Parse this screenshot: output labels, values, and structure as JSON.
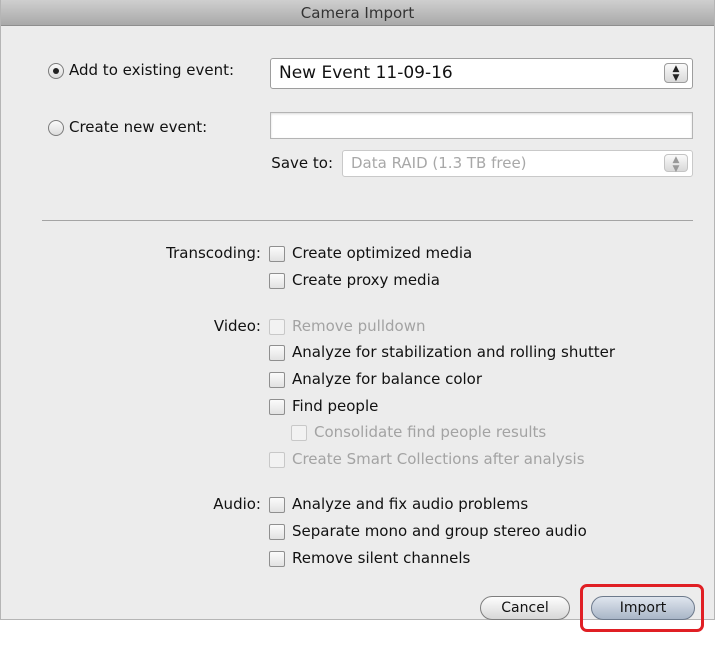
{
  "window": {
    "title": "Camera Import"
  },
  "event": {
    "add_existing_label": "Add to existing event:",
    "add_existing_checked": true,
    "existing_event_value": "New Event 11-09-16",
    "create_new_label": "Create new event:",
    "create_new_checked": false,
    "new_event_value": "",
    "save_to_label": "Save to:",
    "save_to_value": "Data RAID   (1.3 TB free)"
  },
  "transcoding": {
    "label": "Transcoding:",
    "options": [
      {
        "label": "Create optimized media",
        "checked": false,
        "enabled": true
      },
      {
        "label": "Create proxy media",
        "checked": false,
        "enabled": true
      }
    ]
  },
  "video": {
    "label": "Video:",
    "options": [
      {
        "label": "Remove pulldown",
        "checked": false,
        "enabled": false
      },
      {
        "label": "Analyze for stabilization and rolling shutter",
        "checked": false,
        "enabled": true
      },
      {
        "label": "Analyze for balance color",
        "checked": false,
        "enabled": true
      },
      {
        "label": "Find people",
        "checked": false,
        "enabled": true
      },
      {
        "label": "Consolidate find people results",
        "checked": false,
        "enabled": false
      },
      {
        "label": "Create Smart Collections after analysis",
        "checked": false,
        "enabled": false
      }
    ]
  },
  "audio": {
    "label": "Audio:",
    "options": [
      {
        "label": "Analyze and fix audio problems",
        "checked": false,
        "enabled": true
      },
      {
        "label": "Separate mono and group stereo audio",
        "checked": false,
        "enabled": true
      },
      {
        "label": "Remove silent channels",
        "checked": false,
        "enabled": true
      }
    ]
  },
  "buttons": {
    "cancel": "Cancel",
    "import": "Import"
  },
  "colors": {
    "highlight": "#e01f24",
    "default_button": "#a9b6c7"
  }
}
